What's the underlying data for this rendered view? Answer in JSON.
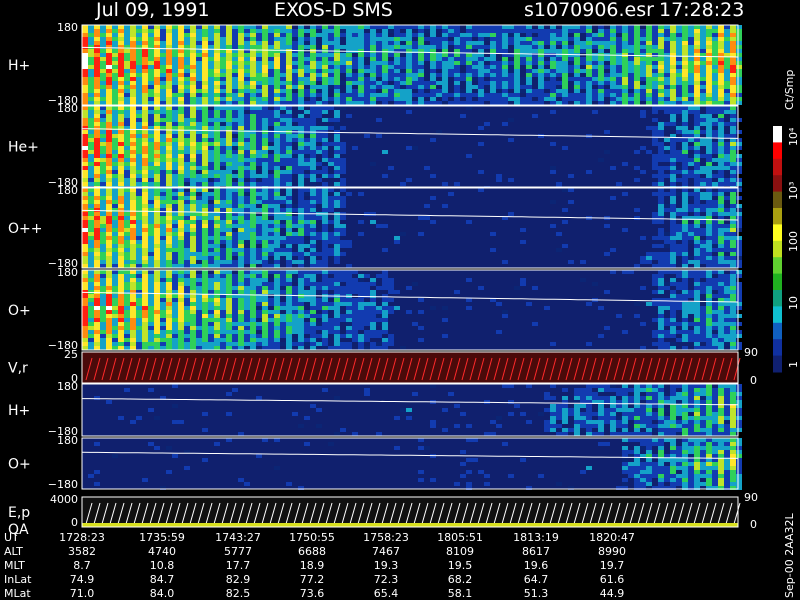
{
  "header": {
    "date": "Jul 09, 1991",
    "instrument": "EXOS-D SMS",
    "file": "s1070906.esr",
    "time": "17:28:23"
  },
  "colorbar": {
    "unit": "Ct/Smp",
    "ticks": [
      "10⁴",
      "10³",
      "100",
      "10",
      "1"
    ]
  },
  "side_note": "Sep-00 2AA32L",
  "chart_data": [
    {
      "type": "heatmap",
      "panel": "H+",
      "label": "H+",
      "ylim": [
        -180,
        180
      ],
      "yticks": [
        "180",
        "−180"
      ],
      "intensity_profile": [
        0.95,
        0.65,
        0.35,
        0.25,
        0.35,
        0.85
      ]
    },
    {
      "type": "heatmap",
      "panel": "He+",
      "label": "He+",
      "ylim": [
        -180,
        180
      ],
      "yticks": [
        "180",
        "−180"
      ],
      "intensity_profile": [
        0.9,
        0.45,
        0.15,
        0.05,
        0.05,
        0.35
      ]
    },
    {
      "type": "heatmap",
      "panel": "O++",
      "label": "O++",
      "ylim": [
        -180,
        180
      ],
      "yticks": [
        "180",
        "−180"
      ],
      "intensity_profile": [
        0.9,
        0.45,
        0.15,
        0.05,
        0.05,
        0.35
      ]
    },
    {
      "type": "heatmap",
      "panel": "O+",
      "label": "O+",
      "ylim": [
        -180,
        180
      ],
      "yticks": [
        "180",
        "−180"
      ],
      "intensity_profile": [
        0.9,
        0.5,
        0.2,
        0.05,
        0.05,
        0.35
      ]
    },
    {
      "type": "line",
      "panel": "V,r",
      "label": "V,r",
      "ylim": [
        0,
        25
      ],
      "yticks": [
        "25",
        "0"
      ],
      "right_ticks": [
        "90",
        "0"
      ]
    },
    {
      "type": "heatmap",
      "panel": "H+ (lower)",
      "label": "H+",
      "ylim": [
        -180,
        180
      ],
      "yticks": [
        "180",
        "−180"
      ],
      "intensity_profile": [
        0.05,
        0.05,
        0.05,
        0.1,
        0.2,
        0.5
      ]
    },
    {
      "type": "heatmap",
      "panel": "O+ (lower)",
      "label": "O+",
      "ylim": [
        -180,
        180
      ],
      "yticks": [
        "180",
        "−180"
      ],
      "intensity_profile": [
        0.05,
        0.05,
        0.05,
        0.05,
        0.1,
        0.55
      ]
    },
    {
      "type": "line",
      "panel": "E,p QA",
      "label": "E,p",
      "label2": "QA",
      "ylim": [
        0,
        4000
      ],
      "yticks": [
        "4000",
        "0"
      ],
      "right_ticks": [
        "90",
        "0"
      ]
    }
  ],
  "ephemeris": {
    "rows": [
      {
        "name": "UT",
        "values": [
          "1728:23",
          "1735:59",
          "1743:27",
          "1750:55",
          "1758:23",
          "1805:51",
          "1813:19",
          "1820:47"
        ]
      },
      {
        "name": "ALT",
        "values": [
          "3582",
          "4740",
          "5777",
          "6688",
          "7467",
          "8109",
          "8617",
          "8990"
        ]
      },
      {
        "name": "MLT",
        "values": [
          "8.7",
          "10.8",
          "17.7",
          "18.9",
          "19.3",
          "19.5",
          "19.6",
          "19.7"
        ]
      },
      {
        "name": "InLat",
        "values": [
          "74.9",
          "84.7",
          "82.9",
          "77.2",
          "72.3",
          "68.2",
          "64.7",
          "61.6"
        ]
      },
      {
        "name": "MLat",
        "values": [
          "71.0",
          "84.0",
          "82.5",
          "73.6",
          "65.4",
          "58.1",
          "51.3",
          "44.9"
        ]
      }
    ]
  }
}
